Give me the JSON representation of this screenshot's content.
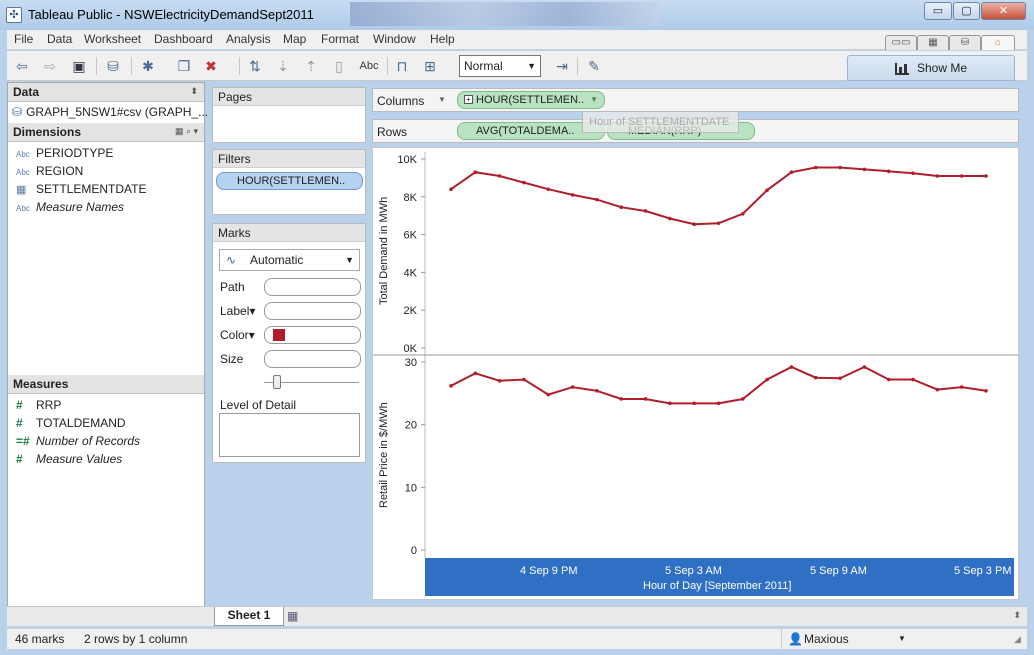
{
  "window": {
    "title": "Tableau Public - NSWElectricityDemandSept2011",
    "controls": {
      "minimize": "▭",
      "maximize": "▢",
      "close": "✕"
    }
  },
  "menu": [
    "File",
    "Data",
    "Worksheet",
    "Dashboard",
    "Analysis",
    "Map",
    "Format",
    "Window",
    "Help"
  ],
  "toolbar": {
    "fit_select": "Normal",
    "show_me": "Show Me",
    "abc_label": "Abc"
  },
  "data_pane": {
    "title": "Data",
    "datasource": "GRAPH_5NSW1#csv (GRAPH_...",
    "dimensions_title": "Dimensions",
    "dimensions": [
      {
        "type": "Abc",
        "name": "PERIODTYPE"
      },
      {
        "type": "Abc",
        "name": "REGION"
      },
      {
        "type": "date",
        "name": "SETTLEMENTDATE"
      },
      {
        "type": "Abc",
        "name": "Measure Names"
      }
    ],
    "measures_title": "Measures",
    "measures": [
      {
        "type": "#",
        "name": "RRP"
      },
      {
        "type": "#",
        "name": "TOTALDEMAND"
      },
      {
        "type": "=#",
        "name": "Number of Records"
      },
      {
        "type": "#",
        "name": "Measure Values"
      }
    ]
  },
  "shelves": {
    "pages_title": "Pages",
    "filters_title": "Filters",
    "filter_pill": "HOUR(SETTLEMEN..",
    "columns_label": "Columns",
    "columns_pill": "HOUR(SETTLEMEN..",
    "rows_label": "Rows",
    "rows_pills": [
      "AVG(TOTALDEMA..",
      "MEDIAN(RRP)"
    ],
    "drag_tooltip": "Hour of SETTLEMENTDATE"
  },
  "marks_card": {
    "title": "Marks",
    "mark_type": "Automatic",
    "rows": [
      "Path",
      "Label",
      "Color",
      "Size"
    ],
    "color_swatch": "#b01e2c",
    "level_of_detail": "Level of Detail"
  },
  "chart_data": {
    "type": "line",
    "color": "#b01e2c",
    "x_title": "Hour of Day [September 2011]",
    "x_tick_labels": [
      "4 Sep 9 PM",
      "5 Sep 3 AM",
      "5 Sep 9 AM",
      "5 Sep 3 PM"
    ],
    "x": [
      "4 Sep 6 PM",
      "4 Sep 7 PM",
      "4 Sep 8 PM",
      "4 Sep 9 PM",
      "4 Sep 10 PM",
      "4 Sep 11 PM",
      "5 Sep 12 AM",
      "5 Sep 1 AM",
      "5 Sep 2 AM",
      "5 Sep 3 AM",
      "5 Sep 4 AM",
      "5 Sep 5 AM",
      "5 Sep 6 AM",
      "5 Sep 7 AM",
      "5 Sep 8 AM",
      "5 Sep 9 AM",
      "5 Sep 10 AM",
      "5 Sep 11 AM",
      "5 Sep 12 PM",
      "5 Sep 1 PM",
      "5 Sep 2 PM",
      "5 Sep 3 PM"
    ],
    "panes": [
      {
        "ylabel": "Total Demand in MWh",
        "ylim": [
          0,
          10000
        ],
        "yticks": [
          0,
          2000,
          4000,
          6000,
          8000,
          10000
        ],
        "ytick_labels": [
          "0K",
          "2K",
          "4K",
          "6K",
          "8K",
          "10K"
        ],
        "series": [
          {
            "name": "AVG(TOTALDEMAND)",
            "values": [
              8400,
              9300,
              9100,
              8750,
              8400,
              8100,
              7850,
              7450,
              7250,
              6850,
              6550,
              6600,
              7100,
              8350,
              9300,
              9550,
              9550,
              9450,
              9350,
              9250,
              9100,
              9100,
              9100
            ]
          }
        ]
      },
      {
        "ylabel": "Retail Price in $/MWh",
        "ylim": [
          0,
          30
        ],
        "yticks": [
          0,
          10,
          20,
          30
        ],
        "ytick_labels": [
          "0",
          "10",
          "20",
          "30"
        ],
        "series": [
          {
            "name": "MEDIAN(RRP)",
            "values": [
              26.2,
              28.2,
              27.0,
              27.2,
              24.8,
              26.0,
              25.4,
              24.1,
              24.1,
              23.4,
              23.4,
              23.4,
              24.1,
              27.2,
              29.2,
              27.5,
              27.4,
              29.2,
              27.2,
              27.2,
              25.6,
              26.0,
              25.4
            ]
          }
        ]
      }
    ]
  },
  "tabs": {
    "sheet": "Sheet 1"
  },
  "status": {
    "marks": "46 marks",
    "dimensions": "2 rows by 1 column",
    "user": "Maxious"
  }
}
